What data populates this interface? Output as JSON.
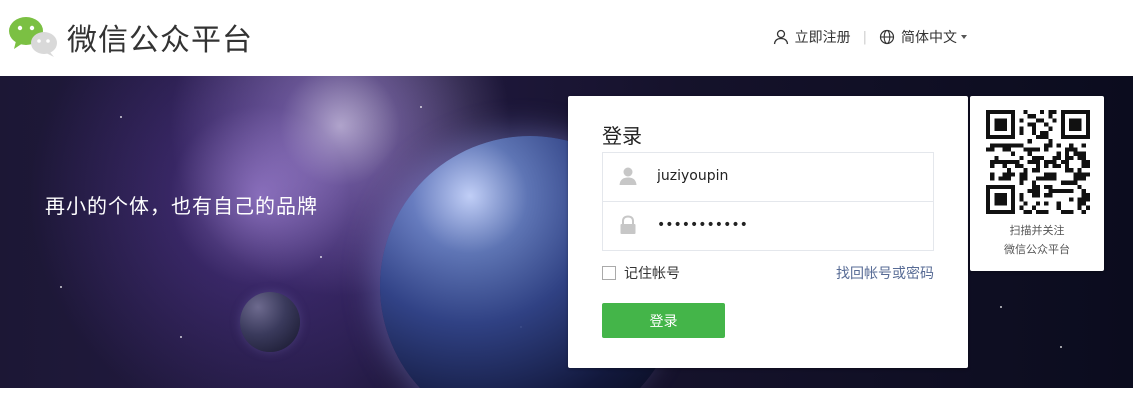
{
  "header": {
    "brand_title": "微信公众平台",
    "register_label": "立即注册",
    "separator": "|",
    "language_label": "简体中文"
  },
  "banner": {
    "slogan": "再小的个体，也有自己的品牌"
  },
  "login": {
    "title": "登录",
    "username_value": "juziyoupin",
    "password_value": "•••••••••••",
    "remember_label": "记住帐号",
    "forgot_label": "找回帐号或密码",
    "submit_label": "登录"
  },
  "qr": {
    "line1": "扫描并关注",
    "line2": "微信公众平台"
  },
  "colors": {
    "accent_green": "#44b549",
    "link_blue": "#576b95",
    "logo_green": "#7bc043"
  },
  "icons": [
    "wechat-logo-icon",
    "user-icon",
    "globe-icon",
    "chevron-down-icon",
    "user-field-icon",
    "lock-icon",
    "qr-code-icon"
  ]
}
